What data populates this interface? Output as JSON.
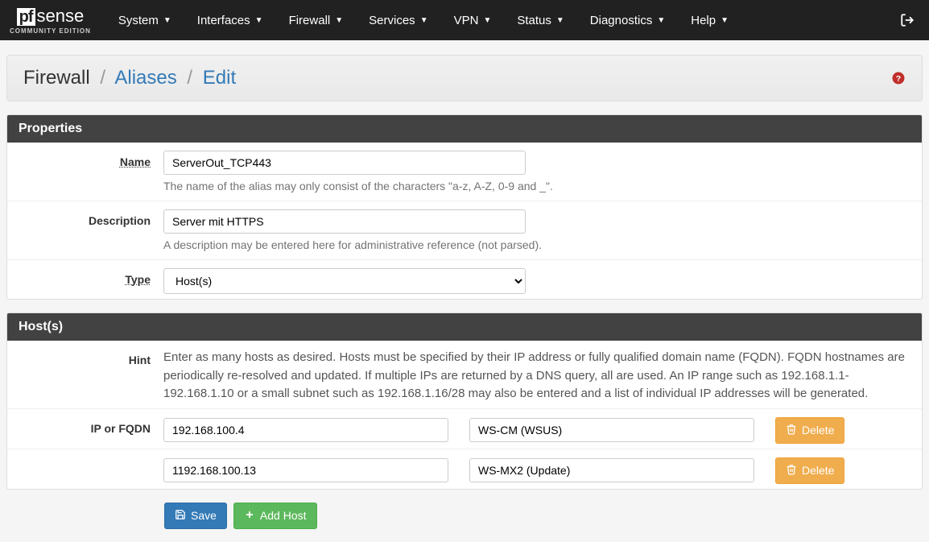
{
  "nav": {
    "items": [
      "System",
      "Interfaces",
      "Firewall",
      "Services",
      "VPN",
      "Status",
      "Diagnostics",
      "Help"
    ],
    "edition": "COMMUNITY EDITION"
  },
  "breadcrumb": {
    "a": "Firewall",
    "b": "Aliases",
    "c": "Edit"
  },
  "panels": {
    "properties_title": "Properties",
    "hosts_title": "Host(s)"
  },
  "labels": {
    "name": "Name",
    "description": "Description",
    "type": "Type",
    "hint": "Hint",
    "ip_or_fqdn": "IP or FQDN"
  },
  "help": {
    "name": "The name of the alias may only consist of the characters \"a-z, A-Z, 0-9 and _\".",
    "description": "A description may be entered here for administrative reference (not parsed).",
    "hint": "Enter as many hosts as desired. Hosts must be specified by their IP address or fully qualified domain name (FQDN). FQDN hostnames are periodically re-resolved and updated. If multiple IPs are returned by a DNS query, all are used. An IP range such as 192.168.1.1-192.168.1.10 or a small subnet such as 192.168.1.16/28 may also be entered and a list of individual IP addresses will be generated."
  },
  "values": {
    "name": "ServerOut_TCP443",
    "description": "Server mit HTTPS",
    "type": "Host(s)"
  },
  "hosts": [
    {
      "ip": "192.168.100.4",
      "desc": "WS-CM (WSUS)"
    },
    {
      "ip": "1192.168.100.13",
      "desc": "WS-MX2 (Update)"
    }
  ],
  "buttons": {
    "delete": "Delete",
    "save": "Save",
    "add_host": "Add Host"
  }
}
